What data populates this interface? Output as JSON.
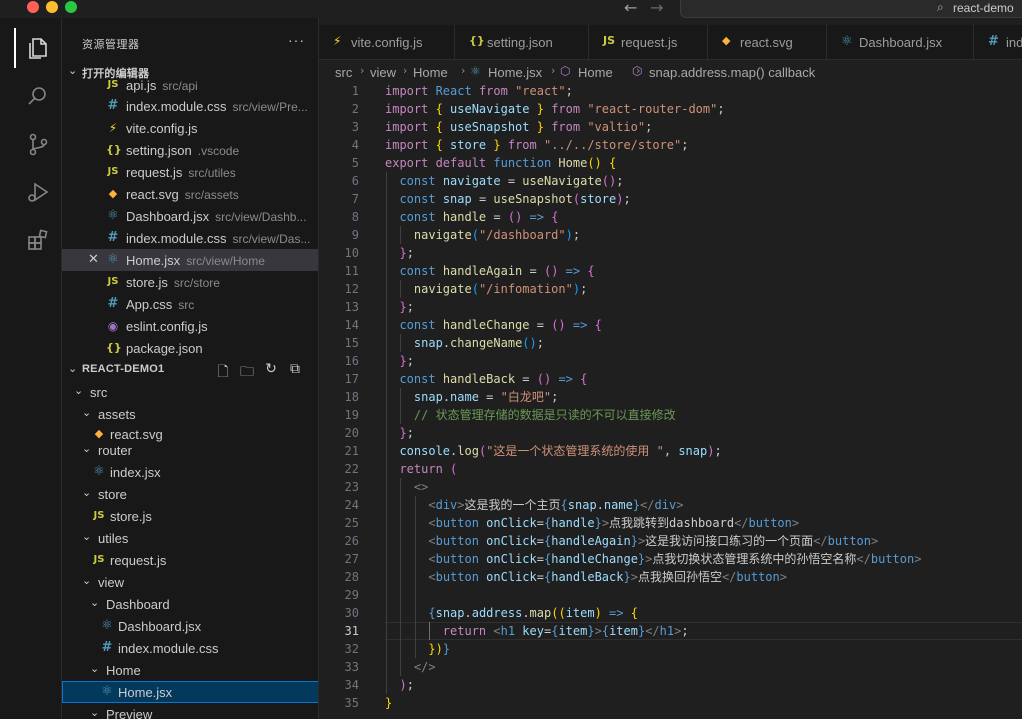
{
  "window": {
    "search_text": "react-demo"
  },
  "sidebar": {
    "title": "资源管理器",
    "more": "···",
    "open_editors": {
      "title": "打开的编辑器",
      "items": [
        {
          "icon": "JS",
          "name": "api.js",
          "path": "src/api"
        },
        {
          "icon": "#",
          "name": "index.module.css",
          "path": "src/view/Pre..."
        },
        {
          "icon": "⚡",
          "name": "vite.config.js",
          "path": ""
        },
        {
          "icon": "{}",
          "name": "setting.json",
          "path": ".vscode"
        },
        {
          "icon": "JS",
          "name": "request.js",
          "path": "src/utiles"
        },
        {
          "icon": "◆",
          "name": "react.svg",
          "path": "src/assets"
        },
        {
          "icon": "⚛",
          "name": "Dashboard.jsx",
          "path": "src/view/Dashb..."
        },
        {
          "icon": "#",
          "name": "index.module.css",
          "path": "src/view/Das..."
        },
        {
          "icon": "⚛",
          "name": "Home.jsx",
          "path": "src/view/Home",
          "close": "✕"
        },
        {
          "icon": "JS",
          "name": "store.js",
          "path": "src/store"
        },
        {
          "icon": "#",
          "name": "App.css",
          "path": "src"
        },
        {
          "icon": "◉",
          "name": "eslint.config.js",
          "path": ""
        },
        {
          "icon": "{}",
          "name": "package.json",
          "path": ""
        }
      ]
    },
    "project": {
      "title": "REACT-DEMO1",
      "tree": [
        {
          "chev": "⌄",
          "icon": "",
          "name": "src"
        },
        {
          "chev": "⌄",
          "icon": "",
          "name": "assets"
        },
        {
          "chev": "",
          "icon": "◆",
          "name": "react.svg"
        },
        {
          "chev": "⌄",
          "icon": "",
          "name": "router"
        },
        {
          "chev": "",
          "icon": "⚛",
          "name": "index.jsx"
        },
        {
          "chev": "⌄",
          "icon": "",
          "name": "store"
        },
        {
          "chev": "",
          "icon": "JS",
          "name": "store.js"
        },
        {
          "chev": "⌄",
          "icon": "",
          "name": "utiles"
        },
        {
          "chev": "",
          "icon": "JS",
          "name": "request.js"
        },
        {
          "chev": "⌄",
          "icon": "",
          "name": "view"
        },
        {
          "chev": "⌄",
          "icon": "",
          "name": "Dashboard"
        },
        {
          "chev": "",
          "icon": "⚛",
          "name": "Dashboard.jsx"
        },
        {
          "chev": "",
          "icon": "#",
          "name": "index.module.css"
        },
        {
          "chev": "⌄",
          "icon": "",
          "name": "Home"
        },
        {
          "chev": "",
          "icon": "⚛",
          "name": "Home.jsx"
        },
        {
          "chev": "⌄",
          "icon": "",
          "name": "Preview"
        }
      ]
    }
  },
  "tabs": [
    {
      "icon": "⚡",
      "label": "vite.config.js"
    },
    {
      "icon": "{}",
      "label": "setting.json"
    },
    {
      "icon": "JS",
      "label": "request.js"
    },
    {
      "icon": "◆",
      "label": "react.svg"
    },
    {
      "icon": "⚛",
      "label": "Dashboard.jsx"
    },
    {
      "icon": "#",
      "label": "index.module.css"
    }
  ],
  "breadcrumb": [
    "src",
    "view",
    "Home",
    "Home.jsx",
    "Home",
    "snap.address.map() callback"
  ],
  "editor": {
    "active_line": 31,
    "lines": [
      [
        [
          "kw",
          "import "
        ],
        [
          "kwb",
          "React "
        ],
        [
          "kw",
          "from "
        ],
        [
          "str",
          "\"react\""
        ],
        [
          "pn",
          ";"
        ]
      ],
      [
        [
          "kw",
          "import "
        ],
        [
          "br1",
          "{ "
        ],
        [
          "var",
          "useNavigate "
        ],
        [
          "br1",
          "} "
        ],
        [
          "kw",
          "from "
        ],
        [
          "str",
          "\"react-router-dom\""
        ],
        [
          "pn",
          ";"
        ]
      ],
      [
        [
          "kw",
          "import "
        ],
        [
          "br1",
          "{ "
        ],
        [
          "var",
          "useSnapshot "
        ],
        [
          "br1",
          "} "
        ],
        [
          "kw",
          "from "
        ],
        [
          "str",
          "\"valtio\""
        ],
        [
          "pn",
          ";"
        ]
      ],
      [
        [
          "kw",
          "import "
        ],
        [
          "br1",
          "{ "
        ],
        [
          "var",
          "store "
        ],
        [
          "br1",
          "} "
        ],
        [
          "kw",
          "from "
        ],
        [
          "str",
          "\"../../store/store\""
        ],
        [
          "pn",
          ";"
        ]
      ],
      [
        [
          "kw",
          "export default "
        ],
        [
          "kwb",
          "function "
        ],
        [
          "fn",
          "Home"
        ],
        [
          "br1",
          "() {"
        ]
      ],
      [
        [
          "pn",
          "  "
        ],
        [
          "kwb",
          "const "
        ],
        [
          "var",
          "navigate "
        ],
        [
          "pn",
          "= "
        ],
        [
          "fn",
          "useNavigate"
        ],
        [
          "br2",
          "()"
        ],
        [
          "pn",
          ";"
        ]
      ],
      [
        [
          "pn",
          "  "
        ],
        [
          "kwb",
          "const "
        ],
        [
          "var",
          "snap "
        ],
        [
          "pn",
          "= "
        ],
        [
          "fn",
          "useSnapshot"
        ],
        [
          "br2",
          "("
        ],
        [
          "var",
          "store"
        ],
        [
          "br2",
          ")"
        ],
        [
          "pn",
          ";"
        ]
      ],
      [
        [
          "pn",
          "  "
        ],
        [
          "kwb",
          "const "
        ],
        [
          "fn",
          "handle "
        ],
        [
          "pn",
          "= "
        ],
        [
          "br2",
          "() "
        ],
        [
          "kwb",
          "=> "
        ],
        [
          "br2",
          "{"
        ]
      ],
      [
        [
          "pn",
          "    "
        ],
        [
          "fn",
          "navigate"
        ],
        [
          "br3",
          "("
        ],
        [
          "str",
          "\"/dashboard\""
        ],
        [
          "br3",
          ")"
        ],
        [
          "pn",
          ";"
        ]
      ],
      [
        [
          "pn",
          "  "
        ],
        [
          "br2",
          "}"
        ],
        [
          "pn",
          ";"
        ]
      ],
      [
        [
          "pn",
          "  "
        ],
        [
          "kwb",
          "const "
        ],
        [
          "fn",
          "handleAgain "
        ],
        [
          "pn",
          "= "
        ],
        [
          "br2",
          "() "
        ],
        [
          "kwb",
          "=> "
        ],
        [
          "br2",
          "{"
        ]
      ],
      [
        [
          "pn",
          "    "
        ],
        [
          "fn",
          "navigate"
        ],
        [
          "br3",
          "("
        ],
        [
          "str",
          "\"/infomation\""
        ],
        [
          "br3",
          ")"
        ],
        [
          "pn",
          ";"
        ]
      ],
      [
        [
          "pn",
          "  "
        ],
        [
          "br2",
          "}"
        ],
        [
          "pn",
          ";"
        ]
      ],
      [
        [
          "pn",
          "  "
        ],
        [
          "kwb",
          "const "
        ],
        [
          "fn",
          "handleChange "
        ],
        [
          "pn",
          "= "
        ],
        [
          "br2",
          "() "
        ],
        [
          "kwb",
          "=> "
        ],
        [
          "br2",
          "{"
        ]
      ],
      [
        [
          "pn",
          "    "
        ],
        [
          "var",
          "snap"
        ],
        [
          "pn",
          "."
        ],
        [
          "fn",
          "changeName"
        ],
        [
          "br3",
          "()"
        ],
        [
          "pn",
          ";"
        ]
      ],
      [
        [
          "pn",
          "  "
        ],
        [
          "br2",
          "}"
        ],
        [
          "pn",
          ";"
        ]
      ],
      [
        [
          "pn",
          "  "
        ],
        [
          "kwb",
          "const "
        ],
        [
          "fn",
          "handleBack "
        ],
        [
          "pn",
          "= "
        ],
        [
          "br2",
          "() "
        ],
        [
          "kwb",
          "=> "
        ],
        [
          "br2",
          "{"
        ]
      ],
      [
        [
          "pn",
          "    "
        ],
        [
          "var",
          "snap"
        ],
        [
          "pn",
          "."
        ],
        [
          "var",
          "name "
        ],
        [
          "pn",
          "= "
        ],
        [
          "str",
          "\"白龙吧\""
        ],
        [
          "pn",
          ";"
        ]
      ],
      [
        [
          "pn",
          "    "
        ],
        [
          "cm",
          "// 状态管理存储的数据是只读的不可以直接修改"
        ]
      ],
      [
        [
          "pn",
          "  "
        ],
        [
          "br2",
          "}"
        ],
        [
          "pn",
          ";"
        ]
      ],
      [
        [
          "pn",
          "  "
        ],
        [
          "var",
          "console"
        ],
        [
          "pn",
          "."
        ],
        [
          "fn",
          "log"
        ],
        [
          "br2",
          "("
        ],
        [
          "str",
          "\"这是一个状态管理系统的使用 \""
        ],
        [
          "pn",
          ", "
        ],
        [
          "var",
          "snap"
        ],
        [
          "br2",
          ")"
        ],
        [
          "pn",
          ";"
        ]
      ],
      [
        [
          "pn",
          "  "
        ],
        [
          "kw",
          "return "
        ],
        [
          "br2",
          "("
        ]
      ],
      [
        [
          "pn",
          "    "
        ],
        [
          "tgray",
          "<>"
        ]
      ],
      [
        [
          "pn",
          "      "
        ],
        [
          "tgray",
          "<"
        ],
        [
          "tag",
          "div"
        ],
        [
          "tgray",
          ">"
        ],
        [
          "pn",
          "这是我的一个主页"
        ],
        [
          "kwb",
          "{"
        ],
        [
          "var",
          "snap"
        ],
        [
          "pn",
          "."
        ],
        [
          "var",
          "name"
        ],
        [
          "kwb",
          "}"
        ],
        [
          "tgray",
          "</"
        ],
        [
          "tag",
          "div"
        ],
        [
          "tgray",
          ">"
        ]
      ],
      [
        [
          "pn",
          "      "
        ],
        [
          "tgray",
          "<"
        ],
        [
          "tag",
          "button "
        ],
        [
          "attr",
          "onClick"
        ],
        [
          "pn",
          "="
        ],
        [
          "kwb",
          "{"
        ],
        [
          "var",
          "handle"
        ],
        [
          "kwb",
          "}"
        ],
        [
          "tgray",
          ">"
        ],
        [
          "pn",
          "点我跳转到dashboard"
        ],
        [
          "tgray",
          "</"
        ],
        [
          "tag",
          "button"
        ],
        [
          "tgray",
          ">"
        ]
      ],
      [
        [
          "pn",
          "      "
        ],
        [
          "tgray",
          "<"
        ],
        [
          "tag",
          "button "
        ],
        [
          "attr",
          "onClick"
        ],
        [
          "pn",
          "="
        ],
        [
          "kwb",
          "{"
        ],
        [
          "var",
          "handleAgain"
        ],
        [
          "kwb",
          "}"
        ],
        [
          "tgray",
          ">"
        ],
        [
          "pn",
          "这是我访问接口练习的一个页面"
        ],
        [
          "tgray",
          "</"
        ],
        [
          "tag",
          "button"
        ],
        [
          "tgray",
          ">"
        ]
      ],
      [
        [
          "pn",
          "      "
        ],
        [
          "tgray",
          "<"
        ],
        [
          "tag",
          "button "
        ],
        [
          "attr",
          "onClick"
        ],
        [
          "pn",
          "="
        ],
        [
          "kwb",
          "{"
        ],
        [
          "var",
          "handleChange"
        ],
        [
          "kwb",
          "}"
        ],
        [
          "tgray",
          ">"
        ],
        [
          "pn",
          "点我切换状态管理系统中的孙悟空名称"
        ],
        [
          "tgray",
          "</"
        ],
        [
          "tag",
          "button"
        ],
        [
          "tgray",
          ">"
        ]
      ],
      [
        [
          "pn",
          "      "
        ],
        [
          "tgray",
          "<"
        ],
        [
          "tag",
          "button "
        ],
        [
          "attr",
          "onClick"
        ],
        [
          "pn",
          "="
        ],
        [
          "kwb",
          "{"
        ],
        [
          "var",
          "handleBack"
        ],
        [
          "kwb",
          "}"
        ],
        [
          "tgray",
          ">"
        ],
        [
          "pn",
          "点我换回孙悟空"
        ],
        [
          "tgray",
          "</"
        ],
        [
          "tag",
          "button"
        ],
        [
          "tgray",
          ">"
        ]
      ],
      [],
      [
        [
          "pn",
          "      "
        ],
        [
          "kwb",
          "{"
        ],
        [
          "var",
          "snap"
        ],
        [
          "pn",
          "."
        ],
        [
          "var",
          "address"
        ],
        [
          "pn",
          "."
        ],
        [
          "fn",
          "map"
        ],
        [
          "br1",
          "(("
        ],
        [
          "var",
          "item"
        ],
        [
          "br1",
          ") "
        ],
        [
          "kwb",
          "=> "
        ],
        [
          "br1",
          "{"
        ]
      ],
      [
        [
          "pn",
          "        "
        ],
        [
          "kw",
          "return "
        ],
        [
          "tgray",
          "<"
        ],
        [
          "tag",
          "h1 "
        ],
        [
          "attr",
          "key"
        ],
        [
          "pn",
          "="
        ],
        [
          "kwb",
          "{"
        ],
        [
          "var",
          "item"
        ],
        [
          "kwb",
          "}"
        ],
        [
          "tgray",
          ">"
        ],
        [
          "kwb",
          "{"
        ],
        [
          "var",
          "item"
        ],
        [
          "kwb",
          "}"
        ],
        [
          "tgray",
          "</"
        ],
        [
          "tag",
          "h1"
        ],
        [
          "tgray",
          ">"
        ],
        [
          "pn",
          ";"
        ]
      ],
      [
        [
          "pn",
          "      "
        ],
        [
          "br1",
          "})"
        ],
        [
          "kwb",
          "}"
        ]
      ],
      [
        [
          "pn",
          "    "
        ],
        [
          "tgray",
          "</>"
        ]
      ],
      [
        [
          "pn",
          "  "
        ],
        [
          "br2",
          ")"
        ],
        [
          "pn",
          ";"
        ]
      ],
      [
        [
          "br1",
          "}"
        ]
      ]
    ]
  }
}
